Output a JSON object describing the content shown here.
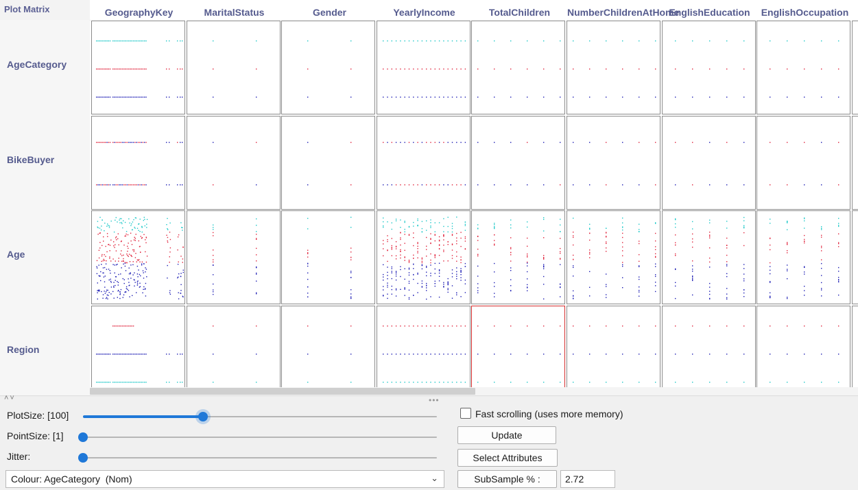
{
  "panel_title": "Plot Matrix",
  "columns": [
    "GeographyKey",
    "MaritalStatus",
    "Gender",
    "YearlyIncome",
    "TotalChildren",
    "NumberChildrenAtHome",
    "EnglishEducation",
    "EnglishOccupation"
  ],
  "rows": [
    "AgeCategory",
    "BikeBuyer",
    "Age",
    "Region"
  ],
  "selected_cell": {
    "row": "Region",
    "column": "TotalChildren"
  },
  "colors": {
    "class_a": "#1b1bb3",
    "class_b": "#e0223a",
    "class_c": "#1ac7c7",
    "selection_border": "#d32a2a",
    "accent": "#1f78d8",
    "header_text": "#555b8e"
  },
  "controls": {
    "plot_size": {
      "label": "PlotSize: [100]",
      "value_fraction": 0.34
    },
    "point_size": {
      "label": "PointSize: [1]",
      "value_fraction": 0.0
    },
    "jitter": {
      "label": "Jitter:",
      "value_fraction": 0.0
    },
    "colour": {
      "value": "Colour: AgeCategory  (Nom)"
    },
    "fast_scrolling": {
      "label": "Fast scrolling (uses more memory)",
      "checked": false
    },
    "update_button": "Update",
    "select_attributes_button": "Select Attributes",
    "subsample_button": "SubSample % :",
    "subsample_value": "2.72"
  },
  "icons": {
    "collapse": "collapse-arrows-icon",
    "drag_handle": "drag-handle-icon",
    "dropdown": "chevron-down-icon"
  }
}
